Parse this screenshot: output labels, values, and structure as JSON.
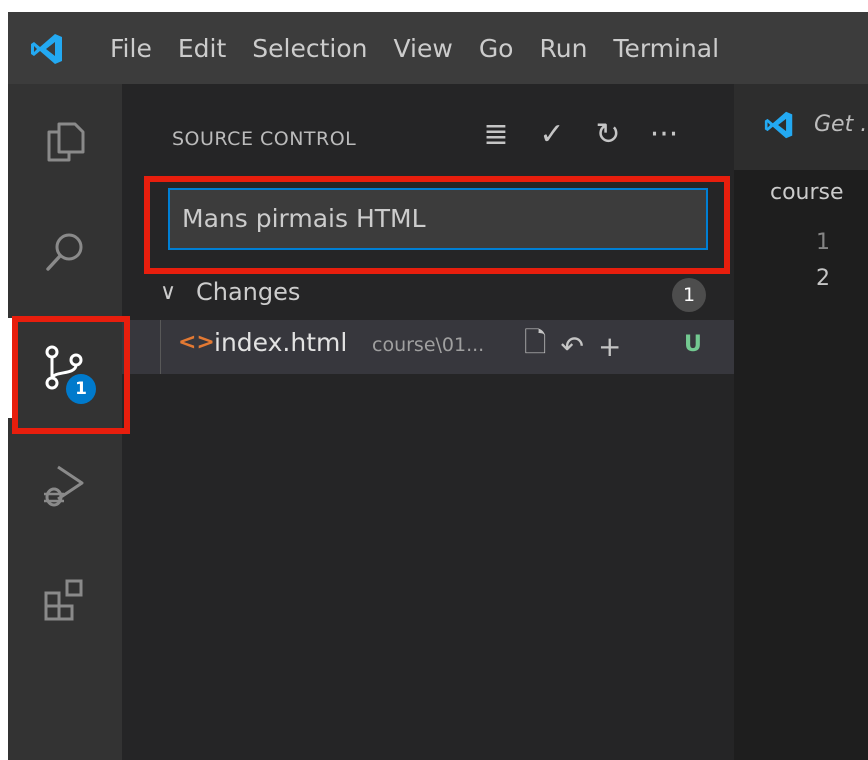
{
  "menu": {
    "items": [
      "File",
      "Edit",
      "Selection",
      "View",
      "Go",
      "Run",
      "Terminal"
    ]
  },
  "activity_bar": {
    "items": [
      "explorer-icon",
      "search-icon",
      "source-control-icon",
      "run-debug-icon",
      "extensions-icon"
    ],
    "active": "source-control-icon",
    "scm_badge": "1"
  },
  "sidebar": {
    "title": "SOURCE CONTROL",
    "actions": {
      "view_tree": "≣",
      "commit": "✓",
      "refresh": "↻",
      "more": "···"
    },
    "commit_message": "Mans pirmais HTML",
    "changes": {
      "label": "Changes",
      "count": "1",
      "files": [
        {
          "icon": "<>",
          "name": "index.html",
          "path": "course\\01...",
          "status": "U"
        }
      ]
    }
  },
  "editor": {
    "tab_label": "Get .",
    "breadcrumb": "course",
    "line_numbers": [
      "1",
      "2"
    ]
  },
  "colors": {
    "accent": "#007acc",
    "highlight": "#e81e0d",
    "untracked": "#73c991",
    "html_icon": "#e37933"
  }
}
